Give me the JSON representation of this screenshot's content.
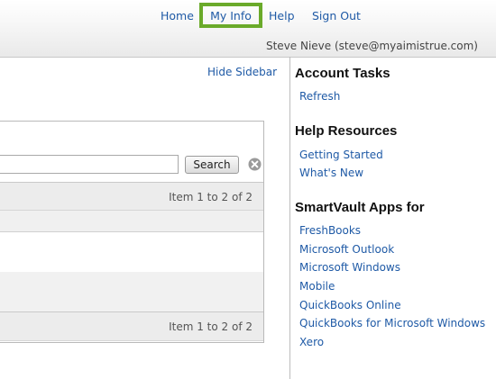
{
  "topnav": {
    "home": "Home",
    "my_info": "My Info",
    "help": "Help",
    "sign_out": "Sign Out"
  },
  "user": {
    "display": "Steve Nieve (steve@myaimistrue.com)"
  },
  "main": {
    "hide_sidebar": "Hide Sidebar",
    "search_button": "Search",
    "pager_top": "Item 1 to 2 of 2",
    "pager_bottom": "Item 1 to 2 of 2"
  },
  "sidebar": {
    "account_tasks": {
      "heading": "Account Tasks",
      "links": [
        "Refresh"
      ]
    },
    "help_resources": {
      "heading": "Help Resources",
      "links": [
        "Getting Started",
        "What's New"
      ]
    },
    "apps": {
      "heading": "SmartVault Apps for",
      "links": [
        "FreshBooks",
        "Microsoft Outlook",
        "Microsoft Windows",
        "Mobile",
        "QuickBooks Online",
        "QuickBooks for Microsoft Windows",
        "Xero"
      ]
    }
  },
  "colors": {
    "link": "#1f5aa6",
    "highlight_border": "#6aaa2a"
  }
}
